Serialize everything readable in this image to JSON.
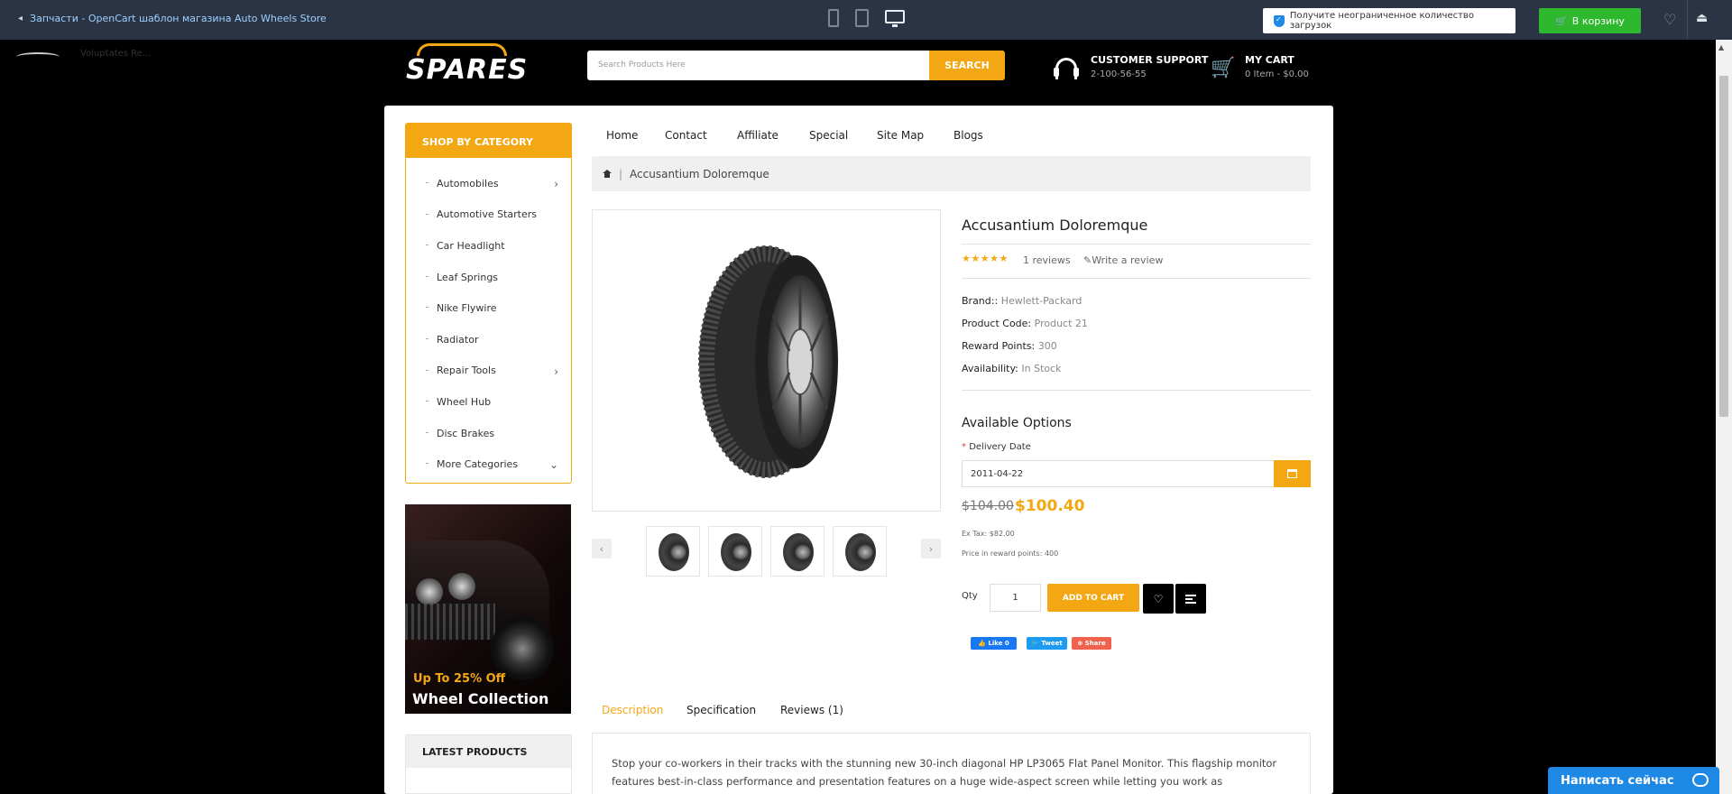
{
  "demo_bar": {
    "back_text": "Запчасти - OpenCart шаблон магазина Auto Wheels Store",
    "promo_text": "Получите неограниченное количество загрузок",
    "cart_button": "В корзину"
  },
  "header": {
    "logo_text": "SPARES",
    "search_placeholder": "Search Products Here",
    "search_button": "SEARCH",
    "support_title": "CUSTOMER SUPPORT",
    "support_phone": "2-100-56-55",
    "cart_title": "MY CART",
    "cart_count": "0 Item - $0.00"
  },
  "categories": {
    "heading": "SHOP BY CATEGORY",
    "items": [
      {
        "label": "Automobiles",
        "arrow": "›"
      },
      {
        "label": "Automotive Starters",
        "arrow": ""
      },
      {
        "label": "Car Headlight",
        "arrow": ""
      },
      {
        "label": "Leaf Springs",
        "arrow": ""
      },
      {
        "label": "Nike Flywire",
        "arrow": ""
      },
      {
        "label": "Radiator",
        "arrow": ""
      },
      {
        "label": "Repair Tools",
        "arrow": "›"
      },
      {
        "label": "Wheel Hub",
        "arrow": ""
      },
      {
        "label": "Disc Brakes",
        "arrow": ""
      },
      {
        "label": "More Categories",
        "arrow": "⌄"
      }
    ]
  },
  "banner": {
    "offer": "Up To 25% Off",
    "title": "Wheel Collection"
  },
  "latest": {
    "heading": "LATEST PRODUCTS",
    "first_item": "Voluptates Re..."
  },
  "nav": [
    "Home",
    "Contact",
    "Affiliate",
    "Special",
    "Site Map",
    "Blogs"
  ],
  "breadcrumb": {
    "separator": "|",
    "current": "Accusantium Doloremque"
  },
  "product": {
    "title": "Accusantium Doloremque",
    "rating": 5,
    "stars": "★★★★★",
    "reviews": "1 reviews",
    "write_review": "Write a review",
    "brand_label": "Brand::",
    "brand": "Hewlett-Packard",
    "code_label": "Product Code:",
    "code": "Product 21",
    "points_label": "Reward Points:",
    "points": "300",
    "availability_label": "Availability:",
    "availability": "In Stock",
    "options_title": "Available Options",
    "delivery_label": "Delivery Date",
    "delivery_value": "2011-04-22",
    "old_price": "$104.00",
    "new_price": "$100.40",
    "ex_tax": "Ex Tax: $82.00",
    "reward_price": "Price in reward points: 400",
    "qty_label": "Qty",
    "qty_value": "1",
    "add_to_cart": "ADD TO CART",
    "thumb_prev": "‹",
    "thumb_next": "›",
    "social": {
      "like": "👍 Like 0",
      "tweet": "🐦 Tweet",
      "share": "⊕ Share"
    }
  },
  "tabs": [
    "Description",
    "Specification",
    "Reviews (1)"
  ],
  "description": "Stop your co-workers in their tracks with the stunning new 30-inch diagonal HP LP3065 Flat Panel Monitor. This flagship monitor features best-in-class performance and presentation features on a huge wide-aspect screen while letting you work as comfortably as possible - you might even forget you're at the office",
  "chat": {
    "label": "Написать сейчас"
  },
  "colors": {
    "accent": "#f3a712",
    "demo_bar": "#2a3444",
    "buy_green": "#2eb82e",
    "chat_blue": "#1e88e5"
  }
}
